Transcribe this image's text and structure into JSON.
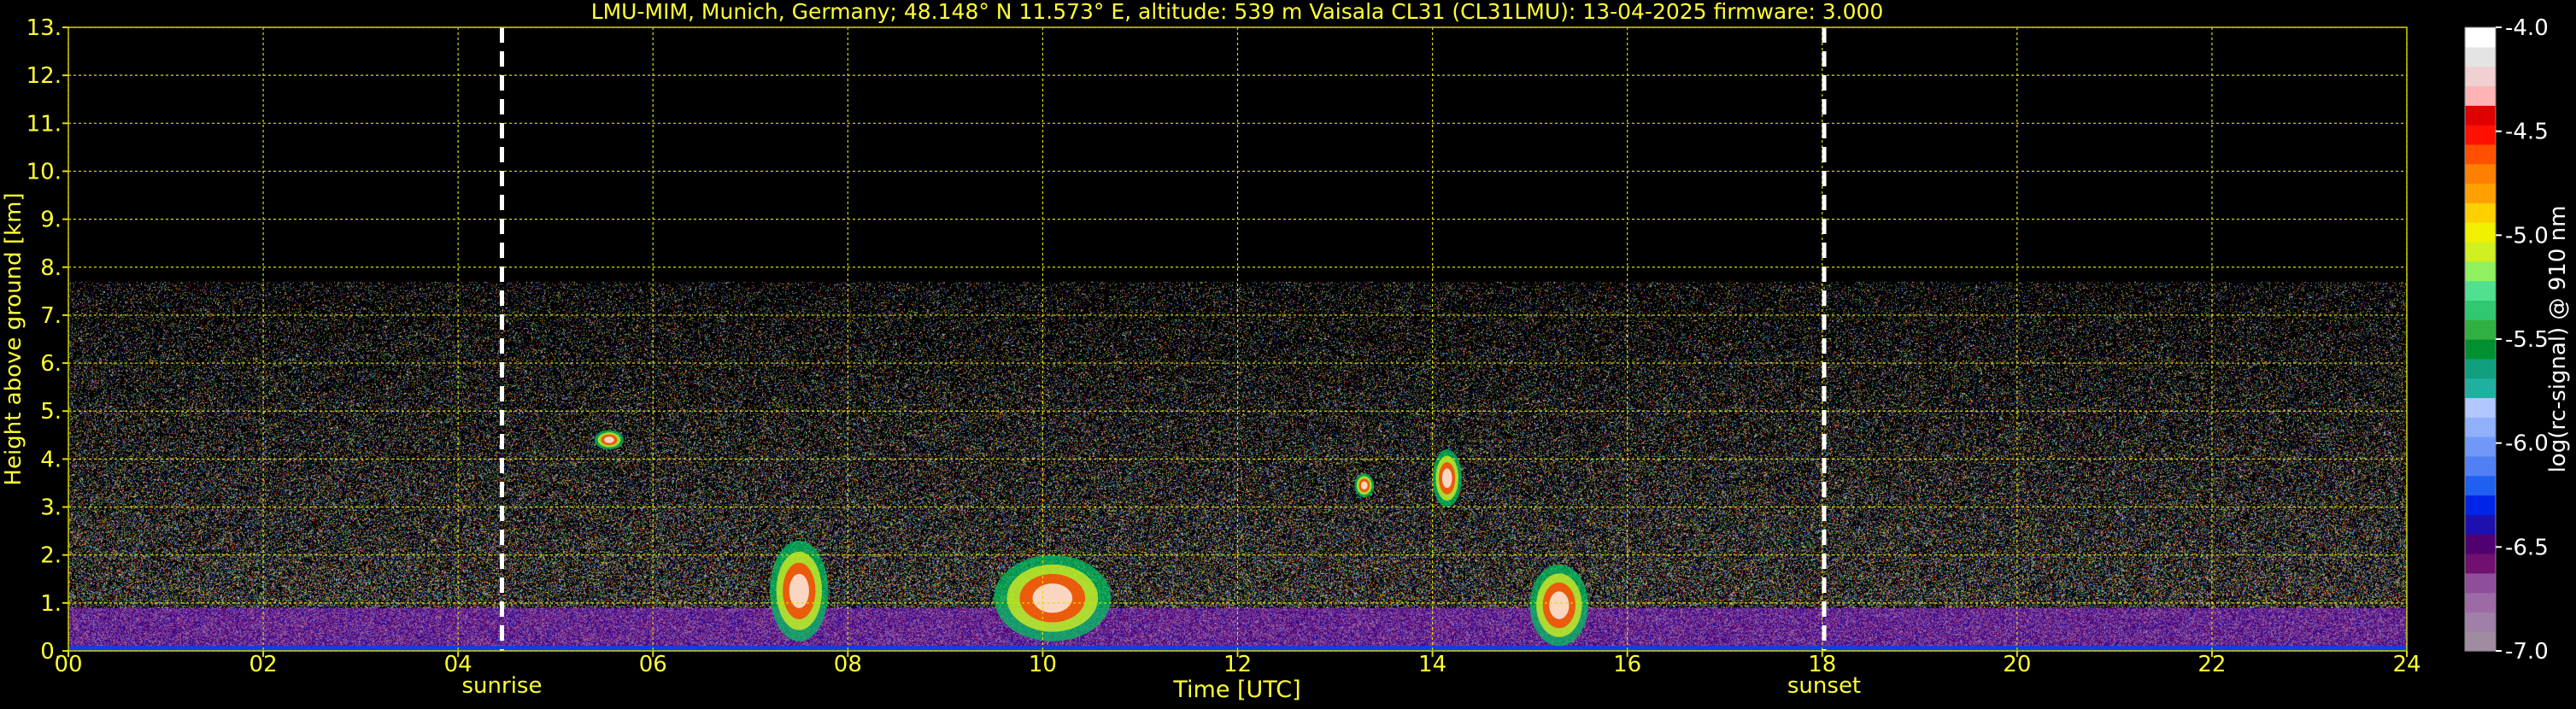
{
  "chart_data": {
    "type": "heatmap",
    "title": "LMU-MIM, Munich, Germany; 48.148° N 11.573° E, altitude: 539 m    Vaisala CL31 (CL31LMU): 13-04-2025    firmware: 3.000",
    "xlabel": "Time [UTC]",
    "ylabel": "Height above ground [km]",
    "xlim": [
      0,
      24
    ],
    "ylim": [
      0,
      13
    ],
    "x_ticks": [
      "00",
      "02",
      "04",
      "06",
      "08",
      "10",
      "12",
      "14",
      "16",
      "18",
      "20",
      "22",
      "24"
    ],
    "y_ticks": [
      "0.",
      "1.",
      "2.",
      "3.",
      "4.",
      "5.",
      "6.",
      "7.",
      "8.",
      "9.",
      "10.",
      "11.",
      "12.",
      "13."
    ],
    "grid": true,
    "measured_height_top_km": 7.7,
    "events": [
      {
        "name": "sunrise",
        "time_utc": 4.45
      },
      {
        "name": "sunset",
        "time_utc": 18.02
      }
    ],
    "colorbar": {
      "label": "log(rc-signal) @ 910 nm",
      "range": [
        -7.0,
        -4.0
      ],
      "ticks": [
        "-4.0",
        "-4.5",
        "-5.0",
        "-5.5",
        "-6.0",
        "-6.5",
        "-7.0"
      ],
      "colors": [
        "#a08ca0",
        "#a080a8",
        "#9c6aa4",
        "#8e4e9a",
        "#701070",
        "#500070",
        "#1d10b0",
        "#0024e8",
        "#2060f0",
        "#5080f4",
        "#7098f8",
        "#90b0fc",
        "#b0c8ff",
        "#20b0a0",
        "#10a080",
        "#009030",
        "#30b040",
        "#30c870",
        "#50e090",
        "#90f060",
        "#d0f020",
        "#f0f000",
        "#ffd000",
        "#ffa000",
        "#ff8000",
        "#ff5000",
        "#ff1000",
        "#e00000",
        "#ffb4b4",
        "#f0d0d0",
        "#e4e4e4",
        "#ffffff"
      ]
    },
    "features": [
      {
        "name": "dense aerosol plume",
        "t": [
          7.2,
          7.8
        ],
        "h": [
          0.2,
          2.3
        ]
      },
      {
        "name": "dense aerosol plume",
        "t": [
          9.5,
          10.7
        ],
        "h": [
          0.2,
          2.0
        ]
      },
      {
        "name": "dense aerosol plume",
        "t": [
          15.0,
          15.6
        ],
        "h": [
          0.1,
          1.8
        ]
      },
      {
        "name": "cloud",
        "t": [
          5.4,
          5.7
        ],
        "h": [
          4.2,
          4.6
        ]
      },
      {
        "name": "cloud",
        "t": [
          13.2,
          13.4
        ],
        "h": [
          3.2,
          3.7
        ]
      },
      {
        "name": "cloud",
        "t": [
          14.0,
          14.3
        ],
        "h": [
          3.0,
          4.2
        ]
      }
    ]
  }
}
